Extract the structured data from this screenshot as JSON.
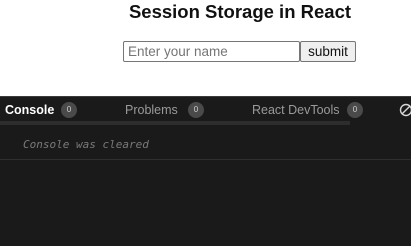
{
  "app": {
    "title": "Session Storage in React",
    "name_input": {
      "placeholder": "Enter your name",
      "value": ""
    },
    "submit_label": "submit"
  },
  "devtools": {
    "tabs": [
      {
        "label": "Console",
        "count": "0",
        "active": true
      },
      {
        "label": "Problems",
        "count": "0",
        "active": false
      },
      {
        "label": "React DevTools",
        "count": "0",
        "active": false
      }
    ],
    "clear_icon": "clear-console-icon",
    "console_messages": [
      "Console was cleared"
    ]
  },
  "colors": {
    "devtools_background": "#1a1a1a",
    "active_tab_text": "#ffffff",
    "inactive_tab_text": "#9a9a9a",
    "badge_background": "#4a4a4a",
    "console_message": "#7a7a7a"
  }
}
